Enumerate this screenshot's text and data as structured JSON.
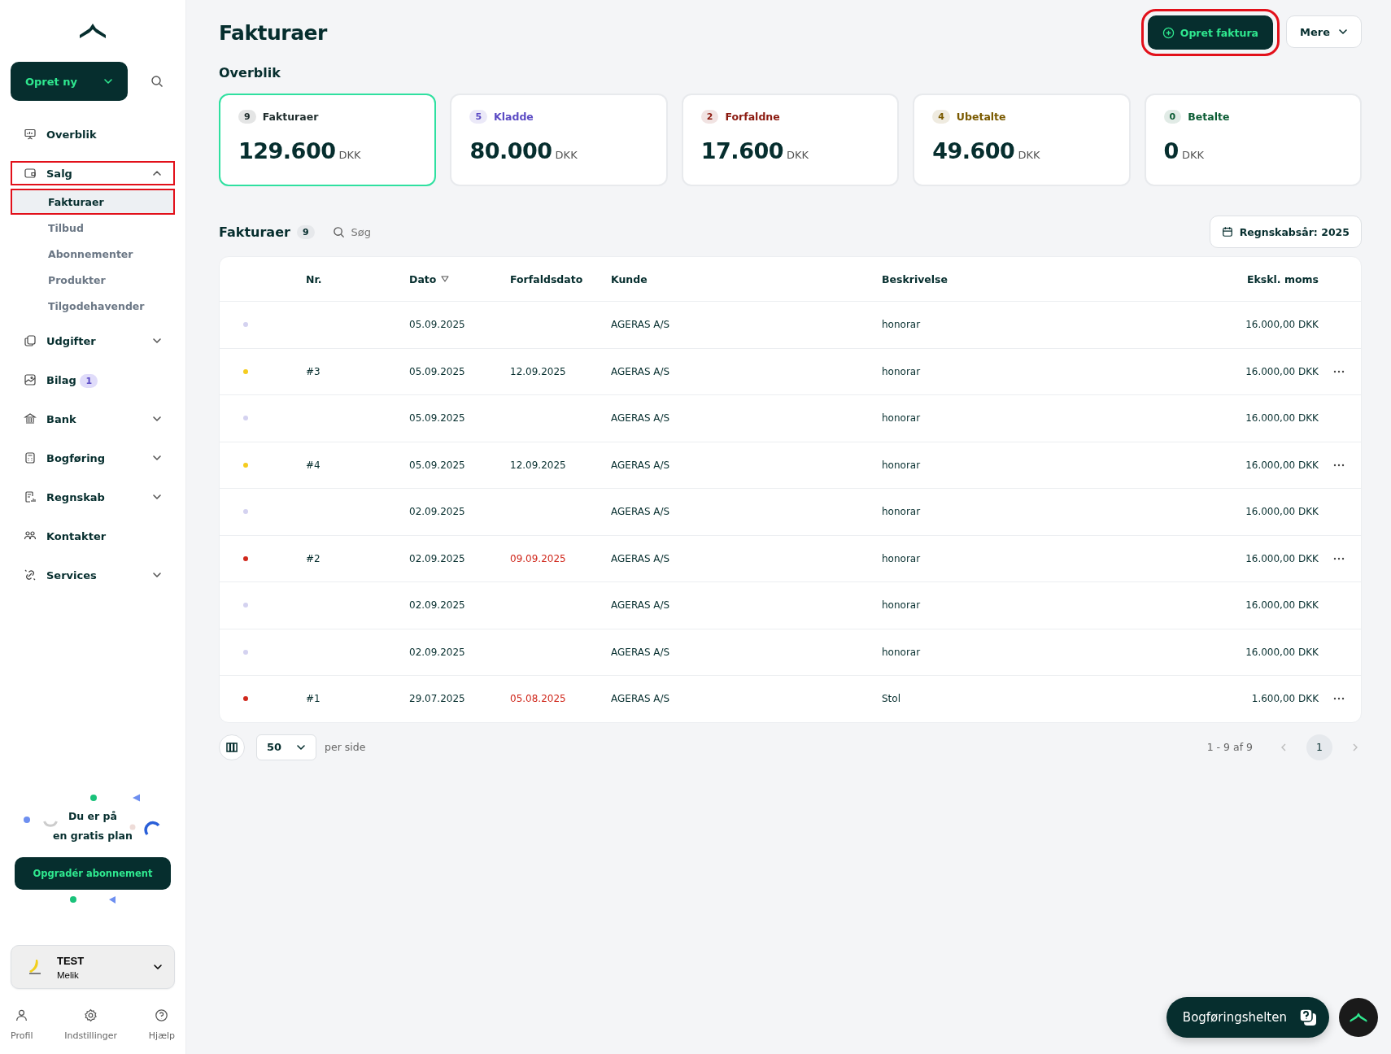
{
  "sidebar": {
    "create_button": {
      "label": "Opret ny"
    },
    "nav": [
      {
        "label": "Overblik"
      },
      {
        "label": "Salg",
        "expanded": true,
        "highlighted": true,
        "children": [
          {
            "label": "Fakturaer",
            "selected": true,
            "highlighted": true
          },
          {
            "label": "Tilbud",
            "selected": false,
            "highlighted": false
          },
          {
            "label": "Abonnementer",
            "selected": false,
            "highlighted": false
          },
          {
            "label": "Produkter",
            "selected": false,
            "highlighted": false
          },
          {
            "label": "Tilgodehavender",
            "selected": false,
            "highlighted": false
          }
        ]
      },
      {
        "label": "Udgifter",
        "expanded": false,
        "highlighted": false
      },
      {
        "label": "Bilag",
        "badge": "1"
      },
      {
        "label": "Bank",
        "expanded": false,
        "highlighted": false
      },
      {
        "label": "Bogføring",
        "expanded": false,
        "highlighted": false
      },
      {
        "label": "Regnskab",
        "expanded": false,
        "highlighted": false
      },
      {
        "label": "Kontakter"
      },
      {
        "label": "Services",
        "expanded": false,
        "highlighted": false
      }
    ],
    "promo": {
      "text_line_1": "Du er på",
      "text_line_2": "en gratis plan",
      "button": "Opgradér abonnement"
    },
    "organization": {
      "name": "TEST",
      "user": "Melik"
    },
    "footer": [
      {
        "label": "Profil"
      },
      {
        "label": "Indstillinger"
      },
      {
        "label": "Hjælp"
      }
    ]
  },
  "header": {
    "title": "Fakturaer",
    "primary_button": {
      "label": "Opret faktura",
      "highlighted": true
    },
    "more_button": {
      "label": "Mere"
    }
  },
  "overview": {
    "title": "Overblik",
    "cards": [
      {
        "count": "9",
        "label": "Fakturaer",
        "amount": "129.600",
        "currency": "DKK",
        "color": "#1f2d2d",
        "selected": true
      },
      {
        "count": "5",
        "label": "Kladde",
        "amount": "80.000",
        "currency": "DKK",
        "color": "#5b4bc4",
        "selected": false
      },
      {
        "count": "2",
        "label": "Forfaldne",
        "amount": "17.600",
        "currency": "DKK",
        "color": "#8b1a10",
        "selected": false
      },
      {
        "count": "4",
        "label": "Ubetalte",
        "amount": "49.600",
        "currency": "DKK",
        "color": "#7a5a00",
        "selected": false
      },
      {
        "count": "0",
        "label": "Betalte",
        "amount": "0",
        "currency": "DKK",
        "color": "#0b5c34",
        "selected": false
      }
    ]
  },
  "invoices": {
    "title": "Fakturaer",
    "count": "9",
    "search": {
      "placeholder": "Søg"
    },
    "fiscal_year_button": "Regnskabsår: 2025",
    "table": {
      "columns": [
        "Nr.",
        "Dato",
        "Forfaldsdato",
        "Kunde",
        "Beskrivelse",
        "Ekskl. moms"
      ],
      "rows": [
        {
          "color": "#d4d2f0",
          "nr": "",
          "date": "05.09.2025",
          "customer": "AGERAS A/S",
          "description": "honorar",
          "amount": "16.000,00 DKK",
          "menu": false
        },
        {
          "color": "#f5cc1f",
          "nr": "#3",
          "date": "05.09.2025",
          "due": "12.09.2025",
          "overdue": false,
          "customer": "AGERAS A/S",
          "description": "honorar",
          "amount": "16.000,00 DKK",
          "menu": true
        },
        {
          "color": "#d4d2f0",
          "nr": "",
          "date": "05.09.2025",
          "customer": "AGERAS A/S",
          "description": "honorar",
          "amount": "16.000,00 DKK",
          "menu": false
        },
        {
          "color": "#f5cc1f",
          "nr": "#4",
          "date": "05.09.2025",
          "due": "12.09.2025",
          "overdue": false,
          "customer": "AGERAS A/S",
          "description": "honorar",
          "amount": "16.000,00 DKK",
          "menu": true
        },
        {
          "color": "#d4d2f0",
          "nr": "",
          "date": "02.09.2025",
          "customer": "AGERAS A/S",
          "description": "honorar",
          "amount": "16.000,00 DKK",
          "menu": false
        },
        {
          "color": "#d0281c",
          "nr": "#2",
          "date": "02.09.2025",
          "due": "09.09.2025",
          "overdue": true,
          "customer": "AGERAS A/S",
          "description": "honorar",
          "amount": "16.000,00 DKK",
          "menu": true
        },
        {
          "color": "#d4d2f0",
          "nr": "",
          "date": "02.09.2025",
          "customer": "AGERAS A/S",
          "description": "honorar",
          "amount": "16.000,00 DKK",
          "menu": false
        },
        {
          "color": "#d4d2f0",
          "nr": "",
          "date": "02.09.2025",
          "customer": "AGERAS A/S",
          "description": "honorar",
          "amount": "16.000,00 DKK",
          "menu": false
        },
        {
          "color": "#d0281c",
          "nr": "#1",
          "date": "29.07.2025",
          "due": "05.08.2025",
          "overdue": true,
          "customer": "AGERAS A/S",
          "description": "Stol",
          "amount": "1.600,00 DKK",
          "menu": true
        }
      ]
    },
    "pagination": {
      "page_size": "50",
      "per_page_label": "per side",
      "range": "1 - 9 af 9",
      "pages": [
        {
          "label": "1",
          "selected": true
        }
      ]
    }
  },
  "help_button": {
    "label": "Bogføringshelten"
  }
}
